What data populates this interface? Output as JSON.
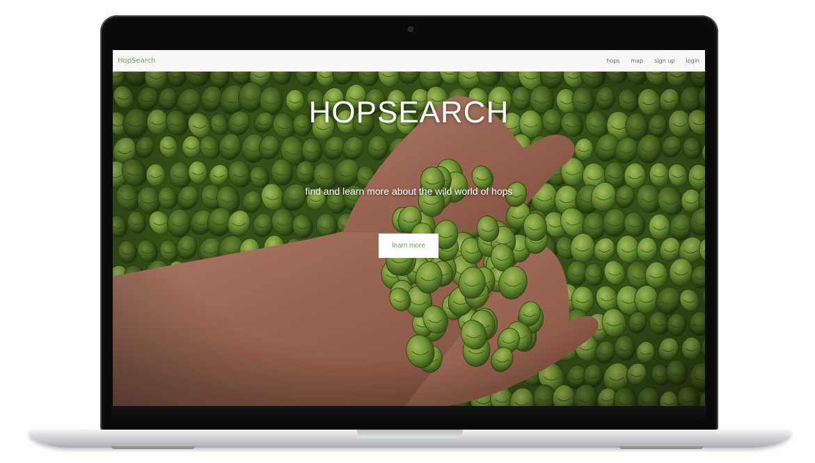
{
  "navbar": {
    "brand": "HopSearch",
    "links": [
      {
        "label": "hops"
      },
      {
        "label": "map"
      },
      {
        "label": "sign up"
      },
      {
        "label": "login"
      }
    ]
  },
  "hero": {
    "title": "HOPSEARCH",
    "subtitle": "find and learn more about the wild world of hops",
    "cta_label": "learn more",
    "background_image": "photo of hands holding a pile of green hop cones"
  },
  "colors": {
    "brand_green": "#6aa744",
    "navbar_bg": "#f8f8f8",
    "hop_green": "#7fa83c",
    "skin": "#b07862"
  }
}
